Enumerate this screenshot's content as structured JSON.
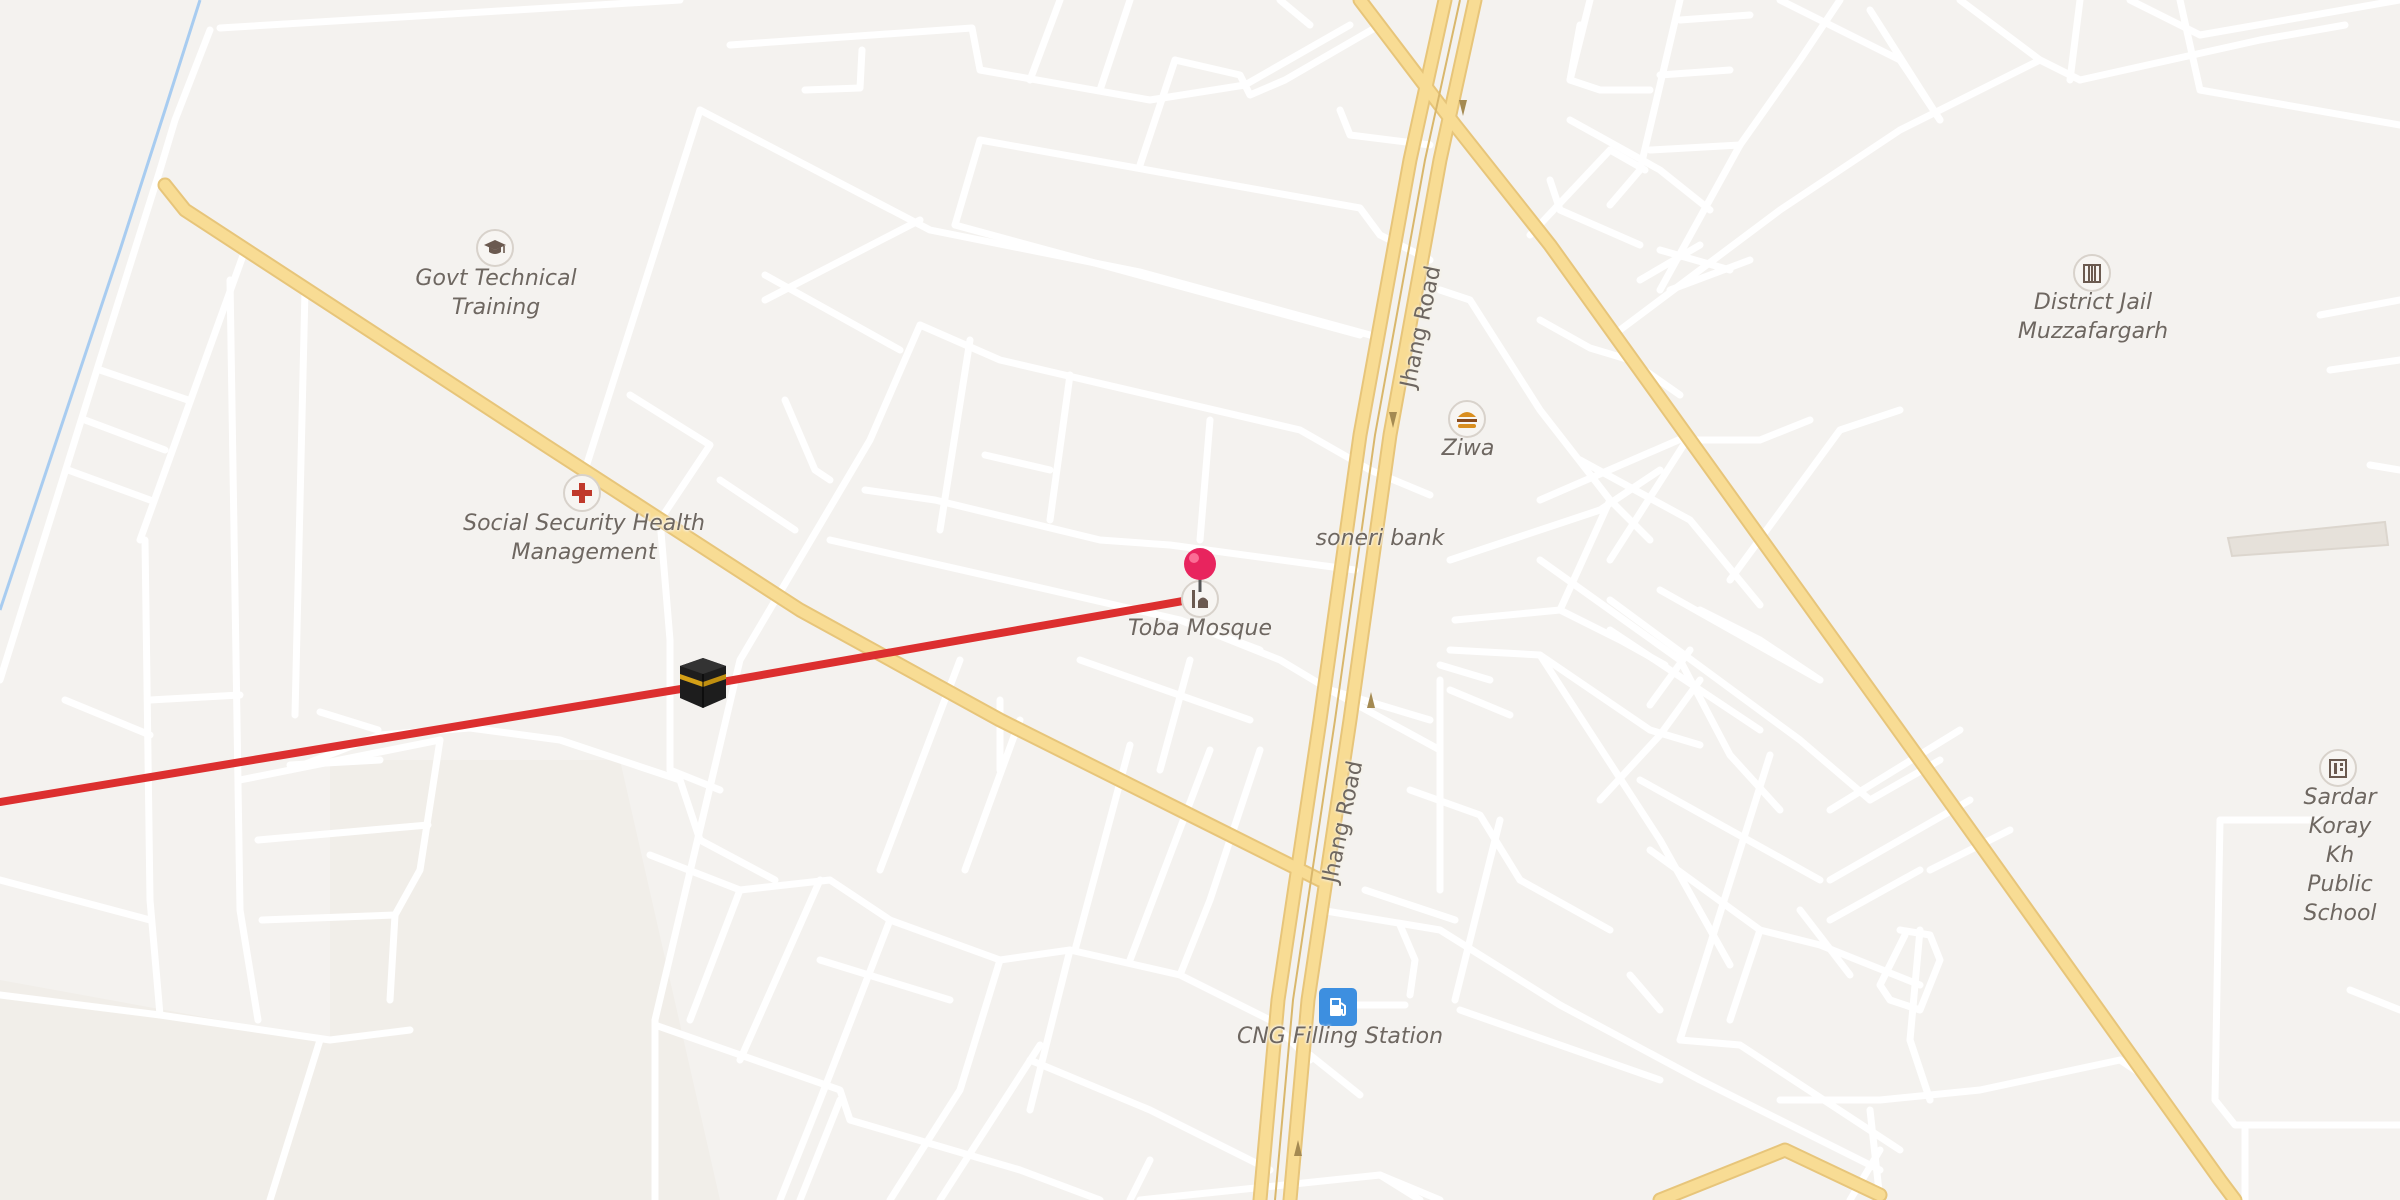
{
  "map": {
    "roads": {
      "jhang_road_upper": "Jhang Road",
      "jhang_road_lower": "Jhang Road"
    },
    "pois": {
      "govt_technical": "Govt Technical\nTraining",
      "social_security": "Social Security Health\nManagement",
      "toba_mosque": "Toba Mosque",
      "soneri_bank": "soneri bank",
      "ziwa": "Ziwa",
      "district_jail": "District Jail\nMuzzafargarh",
      "sardar_koray": "Sardar Koray Kh\nPublic School",
      "cng_station": "CNG Filling Station"
    },
    "icons": {
      "govt_technical": "graduation-cap-icon",
      "social_security": "medical-cross-icon",
      "toba_mosque": "mosque-icon",
      "ziwa": "burger-icon",
      "district_jail": "prison-icon",
      "sardar_koray": "school-icon",
      "cng_station": "fuel-pump-icon",
      "kaaba": "kaaba-icon",
      "selected_pin": "map-pin-icon"
    },
    "colors": {
      "background": "#f4f2ef",
      "street": "#ffffff",
      "main_road": "#f8dc94",
      "route_line": "#dc2f2f",
      "pin": "#e8245e",
      "water": "#a8ccf0"
    }
  }
}
